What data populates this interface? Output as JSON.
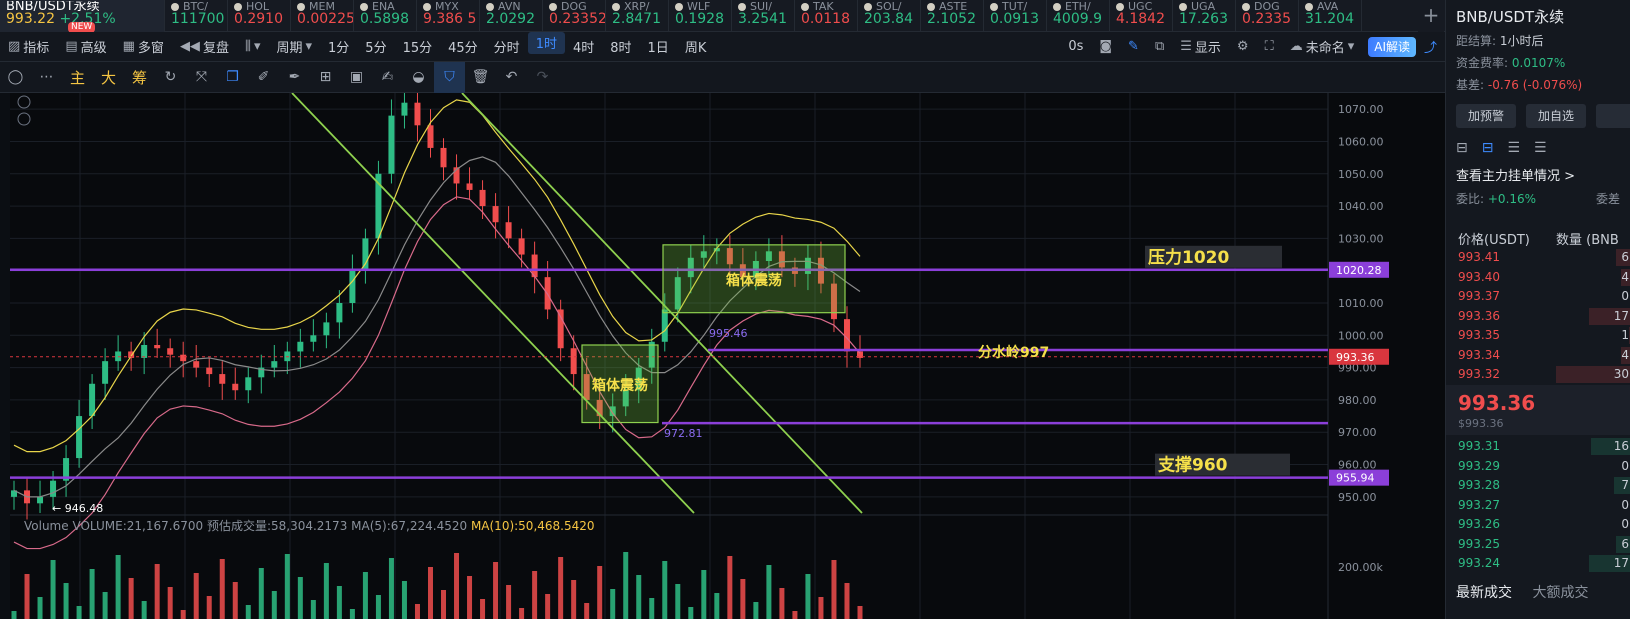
{
  "ticker": {
    "first": {
      "symbol": "BNB/USDT永续",
      "price": "993.22",
      "change": "+2.51%",
      "badge": "NEW"
    },
    "items": [
      {
        "name": "BTC/",
        "price": "111700",
        "dir": "up"
      },
      {
        "name": "HOL",
        "price": "0.2910",
        "dir": "dn"
      },
      {
        "name": "MEM",
        "price": "0.00225",
        "dir": "dn"
      },
      {
        "name": "ENA",
        "price": "0.5898",
        "dir": "up"
      },
      {
        "name": "MYX",
        "price": "9.386 5",
        "dir": "dn"
      },
      {
        "name": "AVN",
        "price": "2.0292",
        "dir": "up"
      },
      {
        "name": "DOG",
        "price": "0.23352",
        "dir": "dn"
      },
      {
        "name": "XRP/",
        "price": "2.8471",
        "dir": "up"
      },
      {
        "name": "WLF",
        "price": "0.1928",
        "dir": "up"
      },
      {
        "name": "SUI/",
        "price": "3.2541",
        "dir": "up"
      },
      {
        "name": "TAK",
        "price": "0.0118",
        "dir": "dn"
      },
      {
        "name": "SOL/",
        "price": "203.84",
        "dir": "up"
      },
      {
        "name": "ASTE",
        "price": "2.1052",
        "dir": "up"
      },
      {
        "name": "TUT/",
        "price": "0.0913",
        "dir": "up"
      },
      {
        "name": "ETH/",
        "price": "4009.9",
        "dir": "up"
      },
      {
        "name": "UGC",
        "price": "4.1842",
        "dir": "dn"
      },
      {
        "name": "UGA",
        "price": "17.263",
        "dir": "up"
      },
      {
        "name": "DOG",
        "price": "0.2335",
        "dir": "dn"
      },
      {
        "name": "AVA",
        "price": "31.204",
        "dir": "up"
      }
    ],
    "plus": "+"
  },
  "toolbar1": {
    "indicators": "指标",
    "advanced": "高级",
    "multi": "多窗",
    "replay": "复盘",
    "period": "周期",
    "intervals": [
      "1分",
      "5分",
      "15分",
      "45分",
      "分时",
      "1时",
      "4时",
      "8时",
      "1日",
      "周K"
    ],
    "active_interval": "1时",
    "zero": "0s",
    "display": "显示",
    "unnamed": "未命名",
    "ai": "AI解读"
  },
  "toolbar2": {
    "main": "主",
    "big": "大",
    "chips": "筹"
  },
  "chart_data": {
    "type": "candlestick",
    "symbol": "BNB/USDT永续",
    "interval": "1时",
    "ylim": [
      945,
      1075
    ],
    "y_ticks": [
      950,
      960,
      970,
      980,
      990,
      1000,
      1010,
      1020,
      1030,
      1040,
      1050,
      1060,
      1070
    ],
    "y_tick_labels": [
      "950.00",
      "960.00",
      "970.00",
      "980.00",
      "990.00",
      "1000.00",
      "1010.00",
      "1020.00",
      "1030.00",
      "1040.00",
      "1050.00",
      "1060.00",
      "1070.00"
    ],
    "current_price": 993.36,
    "horizontal_levels": [
      {
        "value": 1020.28,
        "label": "1020.28",
        "annotation": "压力1020"
      },
      {
        "value": 955.94,
        "label": "955.94",
        "annotation": "支撑960"
      },
      {
        "value": 995.46,
        "label": "995.46",
        "annotation": "分水岭997"
      },
      {
        "value": 972.81,
        "label": "972.81",
        "annotation": ""
      }
    ],
    "boxes": [
      {
        "label": "箱体震荡",
        "y_top": 997,
        "y_bottom": 973
      },
      {
        "label": "箱体震荡",
        "y_top": 1028,
        "y_bottom": 1007
      }
    ],
    "low_marker": "946.48",
    "close_series": [
      952,
      948,
      950,
      955,
      962,
      975,
      985,
      992,
      995,
      993,
      997,
      996,
      994,
      992,
      990,
      988,
      985,
      983,
      987,
      990,
      992,
      995,
      998,
      1000,
      1004,
      1010,
      1020,
      1030,
      1050,
      1068,
      1072,
      1065,
      1058,
      1052,
      1047,
      1045,
      1040,
      1035,
      1030,
      1025,
      1018,
      1008,
      996,
      988,
      980,
      975,
      978,
      983,
      990,
      998,
      1008,
      1018,
      1024,
      1026,
      1027,
      1022,
      1018,
      1023,
      1026,
      1021,
      1019,
      1024,
      1016,
      1005,
      995,
      993
    ],
    "volume_legend": {
      "title": "Volume",
      "volume": "VOLUME:21,167.6700",
      "est": "预估成交量:58,304.2173",
      "ma5": "MA(5):67,224.4520",
      "ma10": "MA(10):50,468.5420"
    },
    "volume_tick": "200.00k"
  },
  "right_panel": {
    "title": "BNB/USDT永续",
    "settle": "距结算:",
    "settle_val": "1小时后",
    "funding": "资金费率:",
    "funding_val": "0.0107%",
    "basis": "基差:",
    "basis_val": "-0.76 (-0.076%)",
    "btn_alert": "加预警",
    "btn_fav": "加自选",
    "view_main": "查看主力挂单情况 >",
    "ratio": "委比:",
    "ratio_val": "+0.16%",
    "ratio_cut": "委差",
    "col_price": "价格(USDT)",
    "col_qty": "数量 (BNB",
    "asks": [
      {
        "p": "993.41",
        "q": "6"
      },
      {
        "p": "993.40",
        "q": "4"
      },
      {
        "p": "993.37",
        "q": "0"
      },
      {
        "p": "993.36",
        "q": "17"
      },
      {
        "p": "993.35",
        "q": "1"
      },
      {
        "p": "993.34",
        "q": "4"
      },
      {
        "p": "993.32",
        "q": "30"
      }
    ],
    "last_price": "993.36",
    "last_sub": "$993.36",
    "bids": [
      {
        "p": "993.31",
        "q": "16"
      },
      {
        "p": "993.29",
        "q": "0"
      },
      {
        "p": "993.28",
        "q": "7"
      },
      {
        "p": "993.27",
        "q": "0"
      },
      {
        "p": "993.26",
        "q": "0"
      },
      {
        "p": "993.25",
        "q": "6"
      },
      {
        "p": "993.24",
        "q": "17"
      }
    ],
    "tab_latest": "最新成交",
    "tab_large": "大额成交"
  }
}
